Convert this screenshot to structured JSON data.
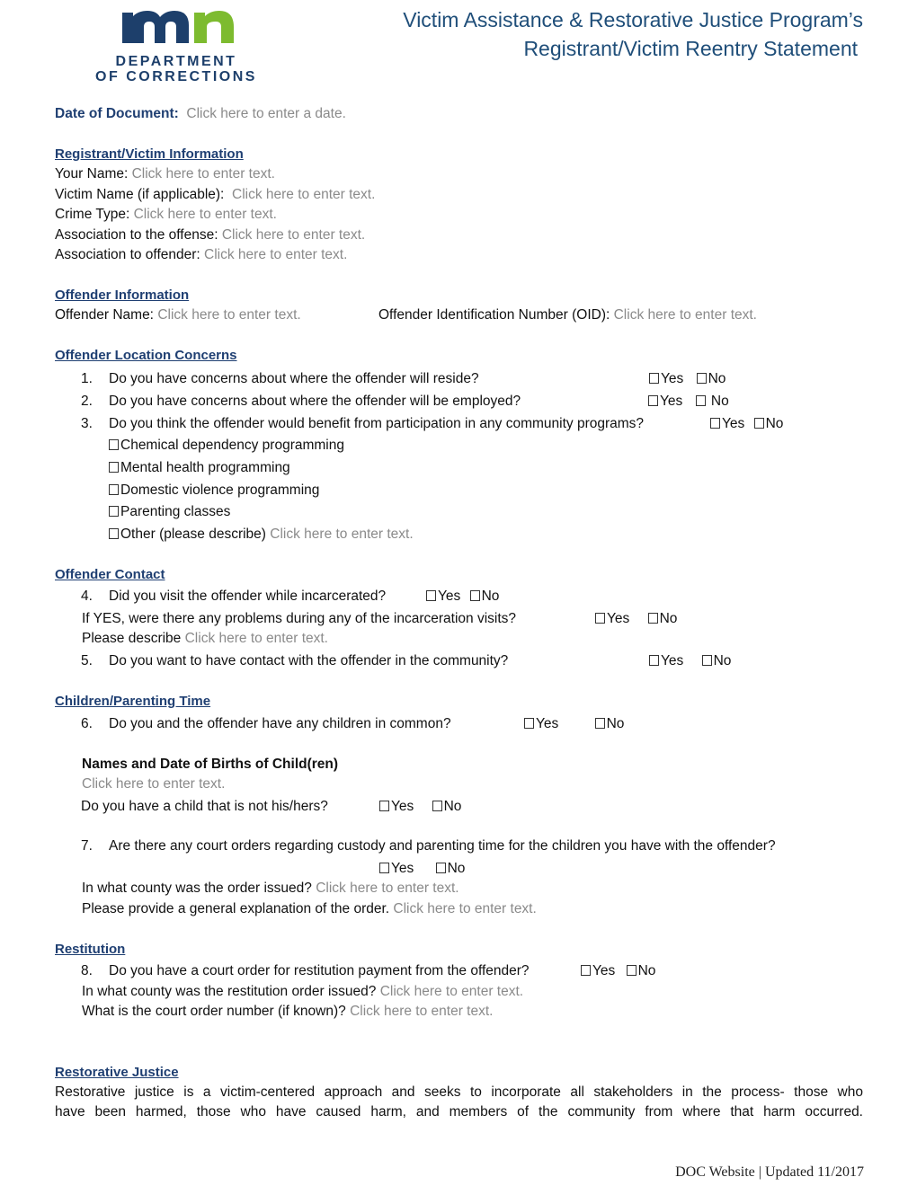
{
  "header": {
    "logo": {
      "mark_colors": {
        "m": "#1d3f6b",
        "n": "#7dbb2f"
      },
      "line1": "DEPARTMENT",
      "line2": "OF CORRECTIONS"
    },
    "title_line1": "Victim Assistance & Restorative Justice Program’s",
    "title_line2": "Registrant/Victim Reentry Statement"
  },
  "date_of_document": {
    "label": "Date of Document:",
    "placeholder": "Click here to enter a date."
  },
  "registrant_info": {
    "heading": "Registrant/Victim Information",
    "fields": [
      {
        "label": "Your Name:",
        "placeholder": "Click here to enter text."
      },
      {
        "label": "Victim Name (if applicable):",
        "placeholder": "Click here to enter text."
      },
      {
        "label": "Crime Type:",
        "placeholder": "Click here to enter text."
      },
      {
        "label": "Association to the offense:",
        "placeholder": "Click here to enter text."
      },
      {
        "label": "Association to offender:",
        "placeholder": "Click here to enter text."
      }
    ]
  },
  "offender_info": {
    "heading": "Offender Information",
    "name_label": "Offender Name:",
    "name_placeholder": "Click here to enter text.",
    "oid_label": "Offender Identification Number (OID):",
    "oid_placeholder": "Click here to enter text."
  },
  "location_concerns": {
    "heading": "Offender Location Concerns",
    "questions": [
      {
        "num": "1.",
        "text": "Do you have concerns about where the offender will reside?",
        "yes": "Yes",
        "no": "No"
      },
      {
        "num": "2.",
        "text": "Do you have concerns about where the offender will be employed?",
        "yes": "Yes",
        "no": " No"
      },
      {
        "num": "3.",
        "text": "Do you think the offender would benefit from participation in any community programs?",
        "yes": "Yes",
        "no": "No"
      }
    ],
    "programs": [
      {
        "label": "Chemical dependency programming"
      },
      {
        "label": "Mental health programming"
      },
      {
        "label": "Domestic violence programming"
      },
      {
        "label": "Parenting classes"
      },
      {
        "label": "Other (please describe)",
        "placeholder": "Click here to enter text."
      }
    ]
  },
  "offender_contact": {
    "heading": "Offender Contact",
    "q4": {
      "num": "4.",
      "text": "Did you visit the offender while incarcerated?",
      "yes": "Yes",
      "no": "No"
    },
    "followup": {
      "text": "If YES, were there any problems during any of the incarceration visits?",
      "yes": "Yes",
      "no": "No"
    },
    "describe": {
      "label": "Please describe",
      "placeholder": "Click here to enter text."
    },
    "q5": {
      "num": "5.",
      "text": "Do you want to have contact with the offender in the community?",
      "yes": "Yes",
      "no": "No"
    }
  },
  "children": {
    "heading": "Children/Parenting Time",
    "q6": {
      "num": "6.",
      "text": "Do you and the offender have any children in common?",
      "yes": "Yes",
      "no": "No"
    },
    "names_heading": "Names and Date of Births of Child(ren)",
    "names_placeholder": "Click here to enter text.",
    "not_his_hers": {
      "text": "Do you have a child that is not his/hers?",
      "yes": "Yes",
      "no": "No"
    },
    "q7": {
      "num": "7.",
      "text": "Are there any court orders regarding custody and parenting time for the children you have with the offender?",
      "yes": "Yes",
      "no": "No"
    },
    "county": {
      "label": "In what county was the order issued?",
      "placeholder": "Click here to enter text."
    },
    "explanation": {
      "label": "Please provide a general explanation of the order.",
      "placeholder": "Click here to enter text."
    }
  },
  "restitution": {
    "heading": "Restitution",
    "q8": {
      "num": "8.",
      "text": "Do you have a court order for restitution payment from the offender?",
      "yes": "Yes",
      "no": "No"
    },
    "county": {
      "label": "In what county was the restitution order issued?",
      "placeholder": "Click here to enter text."
    },
    "order_number": {
      "label": "What is the court order number (if known)?",
      "placeholder": "Click here to enter text."
    }
  },
  "restorative_justice": {
    "heading": "Restorative Justice",
    "line1": "Restorative justice is a victim-centered approach and seeks to incorporate all stakeholders in the process- those who",
    "line2": "have been harmed, those who have caused harm, and members of the community from where that harm occurred."
  },
  "footer": {
    "text": "DOC Website | Updated 11/2017"
  }
}
